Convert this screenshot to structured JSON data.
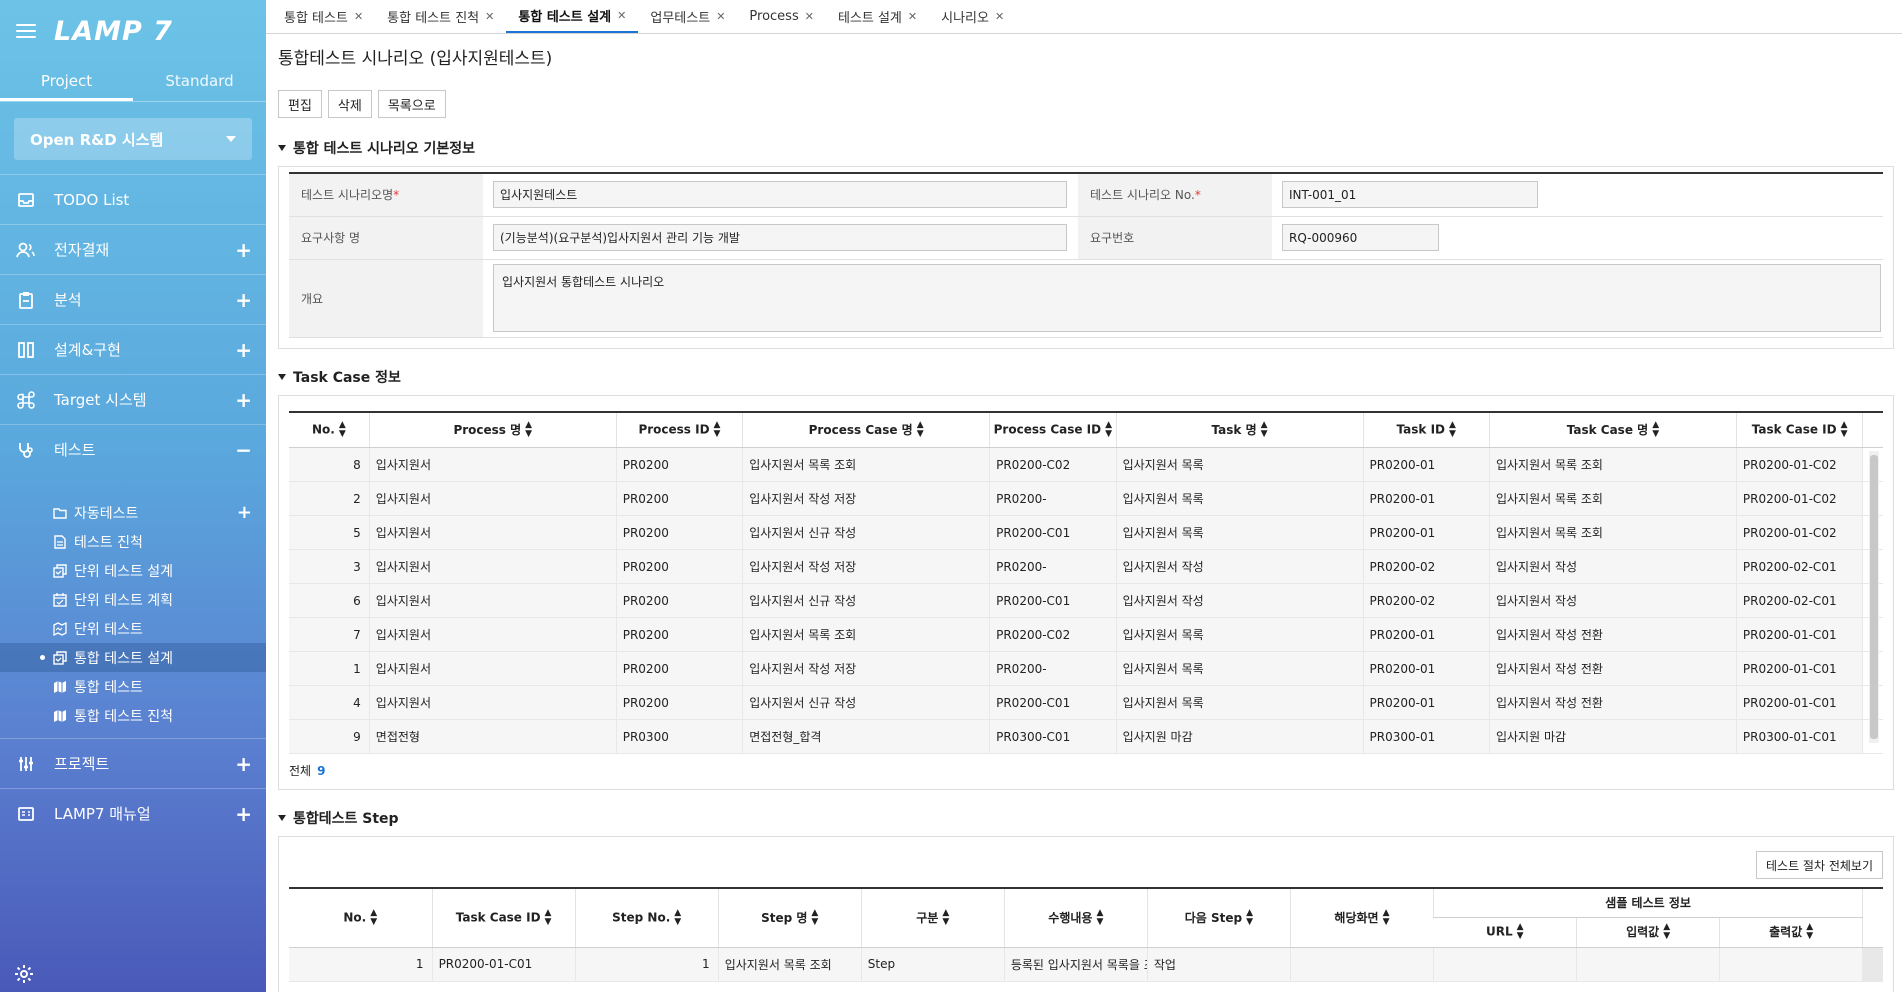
{
  "sidebar": {
    "logo": "LAMP 7",
    "tabs": [
      "Project",
      "Standard"
    ],
    "system_select": "Open R&D 시스템",
    "menu": [
      {
        "label": "TODO List",
        "icon": "inbox-icon",
        "toggle": ""
      },
      {
        "label": "전자결재",
        "icon": "users-icon",
        "toggle": "+"
      },
      {
        "label": "분석",
        "icon": "clipboard-icon",
        "toggle": "+"
      },
      {
        "label": "설계&구현",
        "icon": "columns-icon",
        "toggle": "+"
      },
      {
        "label": "Target 시스템",
        "icon": "command-icon",
        "toggle": "+"
      },
      {
        "label": "테스트",
        "icon": "stethoscope-icon",
        "toggle": "−"
      }
    ],
    "submenu": [
      {
        "label": "자동테스트",
        "icon": "folder-icon",
        "toggle": "+"
      },
      {
        "label": "테스트 진척",
        "icon": "document-icon",
        "toggle": ""
      },
      {
        "label": "단위 테스트 설계",
        "icon": "copy-check-icon",
        "toggle": ""
      },
      {
        "label": "단위 테스트 계획",
        "icon": "calendar-icon",
        "toggle": ""
      },
      {
        "label": "단위 테스트",
        "icon": "map-icon",
        "toggle": ""
      },
      {
        "label": "통합 테스트 설계",
        "icon": "copy-check-icon",
        "toggle": ""
      },
      {
        "label": "통합 테스트",
        "icon": "map-filled-icon",
        "toggle": ""
      },
      {
        "label": "통합 테스트 진척",
        "icon": "map-filled-icon",
        "toggle": ""
      }
    ],
    "menu_bottom": [
      {
        "label": "프로젝트",
        "icon": "sliders-icon",
        "toggle": "+"
      },
      {
        "label": "LAMP7 매뉴얼",
        "icon": "manual-icon",
        "toggle": "+"
      }
    ]
  },
  "tabs": [
    {
      "label": "통합 테스트",
      "active": false
    },
    {
      "label": "통합 테스트 진척",
      "active": false
    },
    {
      "label": "통합 테스트 설계",
      "active": true
    },
    {
      "label": "업무테스트",
      "active": false
    },
    {
      "label": "Process",
      "active": false
    },
    {
      "label": "테스트 설계",
      "active": false
    },
    {
      "label": "시나리오",
      "active": false
    }
  ],
  "page_title": "통합테스트 시나리오 (입사지원테스트)",
  "buttons": {
    "edit": "편집",
    "delete": "삭제",
    "list": "목록으로"
  },
  "basic_info": {
    "section_title": "통합 테스트 시나리오 기본정보",
    "scenario_name_label": "테스트 시나리오명",
    "scenario_name": "입사지원테스트",
    "scenario_no_label": "테스트 시나리오 No.",
    "scenario_no": "INT-001_01",
    "requirement_label": "요구사항 명",
    "requirement": "(기능분석)(요구분석)입사지원서 관리 기능 개발",
    "req_no_label": "요구번호",
    "req_no": "RQ-000960",
    "summary_label": "개요",
    "summary": "입사지원서 통합테스트 시나리오",
    "required_mark": "*"
  },
  "task_case": {
    "section_title": "Task Case 정보",
    "columns": [
      "No.",
      "Process 명",
      "Process ID",
      "Process Case 명",
      "Process Case ID",
      "Task 명",
      "Task ID",
      "Task Case 명",
      "Task Case ID"
    ],
    "rows": [
      [
        "8",
        "입사지원서",
        "PR0200",
        "입사지원서 목록 조회",
        "PR0200-C02",
        "입사지원서 목록",
        "PR0200-01",
        "입사지원서 목록 조회",
        "PR0200-01-C02"
      ],
      [
        "2",
        "입사지원서",
        "PR0200",
        "입사지원서 작성 저장",
        "PR0200-",
        "입사지원서 목록",
        "PR0200-01",
        "입사지원서 목록 조회",
        "PR0200-01-C02"
      ],
      [
        "5",
        "입사지원서",
        "PR0200",
        "입사지원서 신규 작성",
        "PR0200-C01",
        "입사지원서 목록",
        "PR0200-01",
        "입사지원서 목록 조회",
        "PR0200-01-C02"
      ],
      [
        "3",
        "입사지원서",
        "PR0200",
        "입사지원서 작성 저장",
        "PR0200-",
        "입사지원서 작성",
        "PR0200-02",
        "입사지원서 작성",
        "PR0200-02-C01"
      ],
      [
        "6",
        "입사지원서",
        "PR0200",
        "입사지원서 신규 작성",
        "PR0200-C01",
        "입사지원서 작성",
        "PR0200-02",
        "입사지원서 작성",
        "PR0200-02-C01"
      ],
      [
        "7",
        "입사지원서",
        "PR0200",
        "입사지원서 목록 조회",
        "PR0200-C02",
        "입사지원서 목록",
        "PR0200-01",
        "입사지원서 작성 전환",
        "PR0200-01-C01"
      ],
      [
        "1",
        "입사지원서",
        "PR0200",
        "입사지원서 작성 저장",
        "PR0200-",
        "입사지원서 목록",
        "PR0200-01",
        "입사지원서 작성 전환",
        "PR0200-01-C01"
      ],
      [
        "4",
        "입사지원서",
        "PR0200",
        "입사지원서 신규 작성",
        "PR0200-C01",
        "입사지원서 목록",
        "PR0200-01",
        "입사지원서 작성 전환",
        "PR0200-01-C01"
      ],
      [
        "9",
        "면접전형",
        "PR0300",
        "면접전형_합격",
        "PR0300-C01",
        "입사지원 마감",
        "PR0300-01",
        "입사지원 마감",
        "PR0300-01-C01"
      ]
    ],
    "total_label": "전체",
    "total_count": "9"
  },
  "steps": {
    "section_title": "통합테스트 Step",
    "view_all_button": "테스트 절차 전체보기",
    "columns": [
      "No.",
      "Task Case ID",
      "Step No.",
      "Step 명",
      "구분",
      "수행내용",
      "다음 Step",
      "해당화면"
    ],
    "group_header": "샘플 테스트 정보",
    "sub_columns": [
      "URL",
      "입력값",
      "출력값"
    ],
    "rows": [
      [
        "1",
        "PR0200-01-C01",
        "1",
        "입사지원서 목록 조회",
        "Step",
        "등록된 입사지원서 목록을 조회",
        "작업",
        "",
        "",
        "",
        ""
      ]
    ]
  }
}
